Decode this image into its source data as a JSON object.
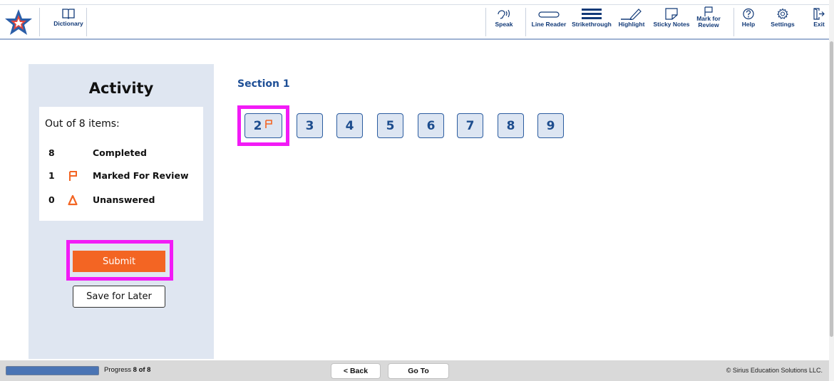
{
  "toolbar": {
    "dictionary_label": "Dictionary",
    "speak_label": "Speak",
    "line_reader_label": "Line Reader",
    "strikethrough_label": "Strikethrough",
    "highlight_label": "Highlight",
    "sticky_notes_label": "Sticky Notes",
    "mark_review_label": "Mark for Review",
    "help_label": "Help",
    "settings_label": "Settings",
    "exit_label": "Exit"
  },
  "activity": {
    "title": "Activity",
    "summary_heading": "Out of 8 items:",
    "rows": [
      {
        "count": "8",
        "label": "Completed",
        "icon": "none"
      },
      {
        "count": "1",
        "label": "Marked For Review",
        "icon": "flag-icon"
      },
      {
        "count": "0",
        "label": "Unanswered",
        "icon": "warning-icon"
      }
    ],
    "submit_label": "Submit",
    "save_label": "Save for Later"
  },
  "section": {
    "title": "Section 1",
    "questions": [
      "2",
      "3",
      "4",
      "5",
      "6",
      "7",
      "8",
      "9"
    ],
    "current": "2",
    "current_flagged": true
  },
  "footer": {
    "progress_prefix": "Progress",
    "progress_value": "8 of 8",
    "progress_fraction": 1.0,
    "back_label": "< Back",
    "goto_label": "Go To",
    "copyright": "© Sirius Education Solutions LLC."
  },
  "colors": {
    "accent_blue": "#1e4f96",
    "highlight_magenta": "#f21bf6",
    "submit_orange": "#f36523",
    "flag_orange": "#f36523",
    "panel_bg": "#dfe6f1"
  }
}
